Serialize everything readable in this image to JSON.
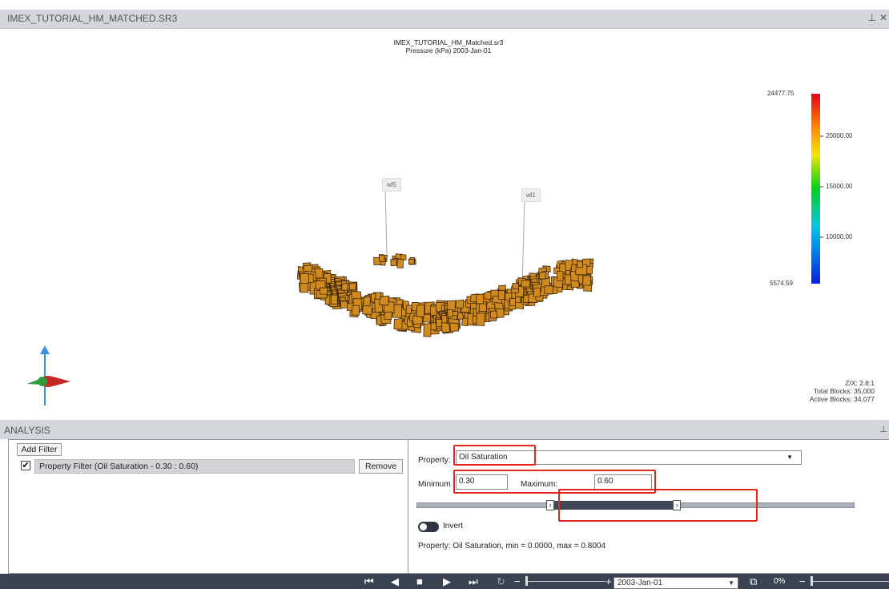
{
  "window": {
    "title": "IMEX_TUTORIAL_HM_MATCHED.SR3",
    "pin_icon": "pin-icon",
    "close_icon": "close-icon"
  },
  "plot": {
    "title_line1": "IMEX_TUTORIAL_HM_Matched.sr3",
    "title_line2": "Pressure (kPa)  2003-Jan-01",
    "wells": [
      "wl5",
      "wl1"
    ],
    "legend": {
      "max": "24477.75",
      "min": "5574.59",
      "ticks": [
        "20000.00",
        "15000.00",
        "10000.00"
      ]
    },
    "block_color": "#d08a1e",
    "stats": {
      "ratio": "Z/X: 2.8:1",
      "total": "Total Blocks: 35,000",
      "active": "Active Blocks: 34,077"
    }
  },
  "analysis": {
    "title": "ANALYSIS",
    "add_filter_label": "Add Filter",
    "filter_item": "Property Filter (Oil Saturation - 0.30 : 0.60)",
    "filter_checked": "✔",
    "remove_label": "Remove",
    "property_label": "Property:",
    "property_value": "Oil Saturation",
    "minimum_label": "Minimum",
    "minimum_value": "0.30",
    "maximum_label": "Maximum:",
    "maximum_value": "0.60",
    "range_low_fraction": 0.3,
    "range_high_fraction": 0.6,
    "invert_label": "Invert",
    "invert_on": false,
    "summary": "Property: Oil Saturation, min = 0.0000, max = 0.8004",
    "highlight_color": "#e5241f"
  },
  "player": {
    "date": "2003-Jan-01",
    "zoom_pct": "0%",
    "icons": [
      "skip-start-icon",
      "step-back-icon",
      "stop-icon",
      "play-icon",
      "skip-end-icon",
      "loop-icon"
    ]
  }
}
